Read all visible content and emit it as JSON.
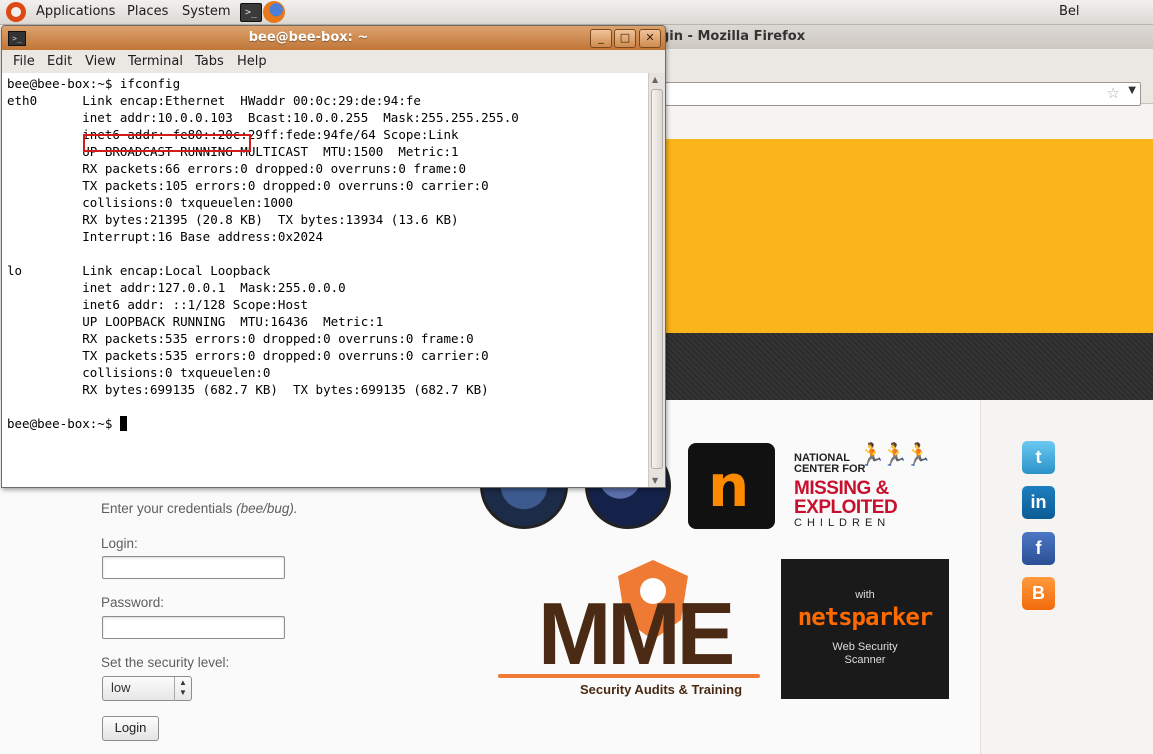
{
  "top_panel": {
    "applications": "Applications",
    "places": "Places",
    "system": "System",
    "user": "Bel"
  },
  "firefox": {
    "title_partial": "gin - Mozilla Firefox"
  },
  "terminal": {
    "title": "bee@bee-box: ~",
    "menu": [
      "File",
      "Edit",
      "View",
      "Terminal",
      "Tabs",
      "Help"
    ],
    "lines": [
      "bee@bee-box:~$ ifconfig",
      "eth0      Link encap:Ethernet  HWaddr 00:0c:29:de:94:fe",
      "          inet addr:10.0.0.103  Bcast:10.0.0.255  Mask:255.255.255.0",
      "          inet6 addr: fe80::20c:29ff:fede:94fe/64 Scope:Link",
      "          UP BROADCAST RUNNING MULTICAST  MTU:1500  Metric:1",
      "          RX packets:66 errors:0 dropped:0 overruns:0 frame:0",
      "          TX packets:105 errors:0 dropped:0 overruns:0 carrier:0",
      "          collisions:0 txqueuelen:1000",
      "          RX bytes:21395 (20.8 KB)  TX bytes:13934 (13.6 KB)",
      "          Interrupt:16 Base address:0x2024",
      "",
      "lo        Link encap:Local Loopback",
      "          inet addr:127.0.0.1  Mask:255.0.0.0",
      "          inet6 addr: ::1/128 Scope:Host",
      "          UP LOOPBACK RUNNING  MTU:16436  Metric:1",
      "          RX packets:535 errors:0 dropped:0 overruns:0 frame:0",
      "          TX packets:535 errors:0 dropped:0 overruns:0 carrier:0",
      "          collisions:0 txqueuelen:0",
      "          RX bytes:699135 (682.7 KB)  TX bytes:699135 (682.7 KB)",
      ""
    ],
    "prompt": "bee@bee-box:~$ ",
    "highlight_color": "#d21c1c"
  },
  "login_page": {
    "credentials_text": "Enter your credentials ",
    "credentials_hint": "(bee/bug).",
    "login_label": "Login:",
    "password_label": "Password:",
    "security_label": "Set the security level:",
    "security_value": "low",
    "login_button": "Login",
    "banner_color": "#fbb419"
  },
  "sponsors": {
    "ncmec_line1": "NATIONAL",
    "ncmec_line2": "CENTER FOR",
    "ncmec_line3": "MISSING &",
    "ncmec_line4": "EXPLOITED",
    "ncmec_line5": "CHILDREN",
    "mme": "MME",
    "mme_tagline": "Security Audits & Training",
    "netsparker_with": "with",
    "netsparker_brand": "netsparker",
    "netsparker_sub1": "Web Security",
    "netsparker_sub2": "Scanner"
  },
  "social": [
    "twitter-icon",
    "linkedin-icon",
    "facebook-icon",
    "blogger-icon"
  ]
}
